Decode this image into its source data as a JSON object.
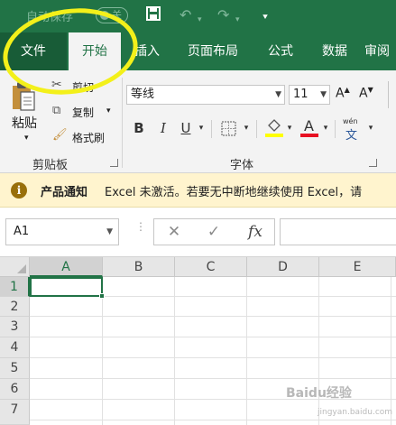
{
  "titlebar": {
    "autosave_label": "自动保存",
    "autosave_state": "关",
    "icons": [
      "save-icon",
      "undo-icon",
      "redo-icon",
      "customize-icon"
    ]
  },
  "tabs": [
    {
      "label": "文件"
    },
    {
      "label": "开始"
    },
    {
      "label": "插入"
    },
    {
      "label": "页面布局"
    },
    {
      "label": "公式"
    },
    {
      "label": "数据"
    },
    {
      "label": "审阅"
    }
  ],
  "ribbon": {
    "clipboard": {
      "paste_label": "粘贴",
      "cut_label": "剪切",
      "copy_label": "复制",
      "format_painter_label": "格式刷",
      "group_label": "剪贴板"
    },
    "font": {
      "font_name": "等线",
      "font_size": "11",
      "bold": "B",
      "italic": "I",
      "underline": "U",
      "group_label": "字体",
      "highlight_color": "#ffff00",
      "font_color": "#e81123",
      "phonetic_label": "wén"
    }
  },
  "notice": {
    "title": "产品通知",
    "message": "Excel 未激活。若要无中断地继续使用 Excel，请"
  },
  "formula_bar": {
    "name_box": "A1",
    "cancel": "✕",
    "enter": "✓",
    "fx": "fx"
  },
  "grid": {
    "columns": [
      "A",
      "B",
      "C",
      "D",
      "E"
    ],
    "rows": [
      "1",
      "2",
      "3",
      "4",
      "5",
      "6",
      "7"
    ],
    "active_cell": "A1"
  },
  "accent_color": "#217346",
  "watermark": "Baidu经验",
  "watermark_sub": "jingyan.baidu.com"
}
